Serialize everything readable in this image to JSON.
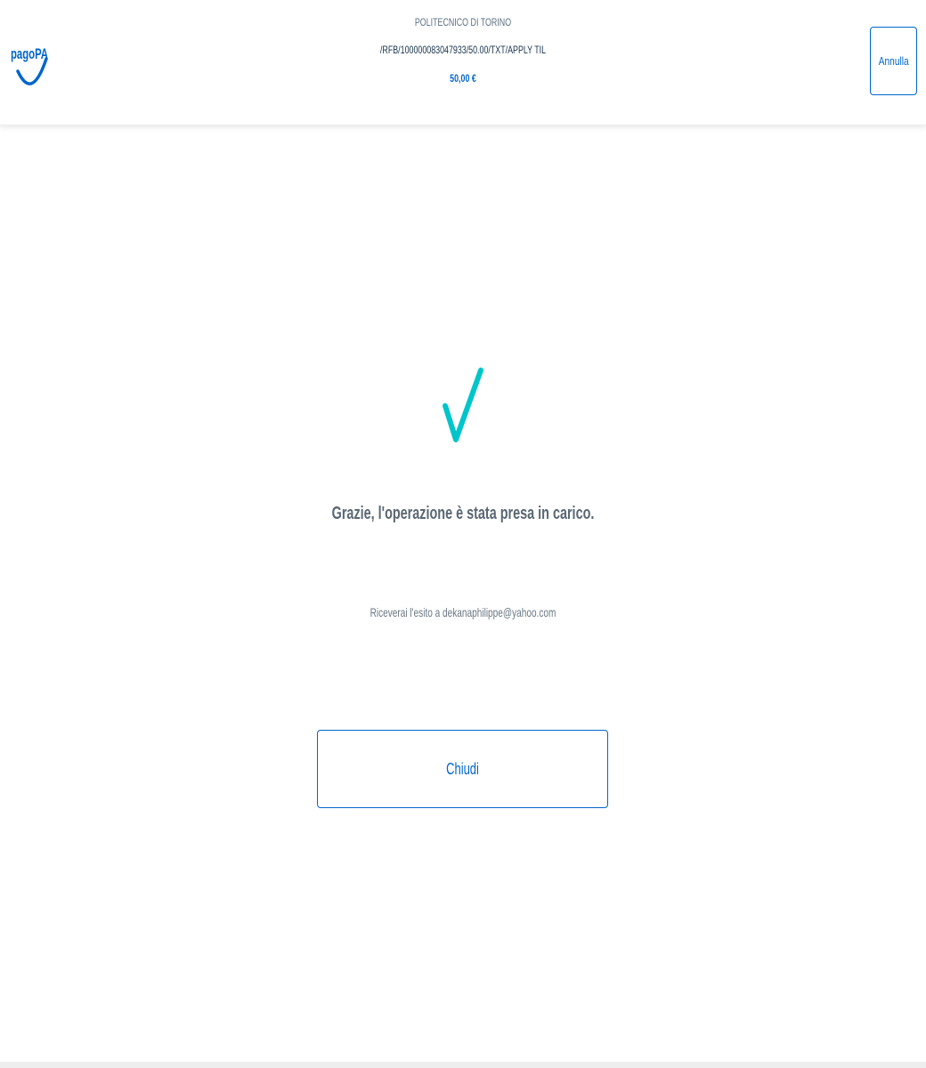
{
  "header": {
    "logo_text": "pagoPA",
    "creditor": "POLITECNICO DI TORINO",
    "subject": "/RFB/100000083047933/50.00/TXT/APPLY TIL",
    "amount": "50,00 €",
    "cancel_label": "Annulla"
  },
  "result": {
    "icon": "checkmark-icon",
    "message": "Grazie, l'operazione è stata presa in carico.",
    "email_note": "Riceverai l'esito a dekanaphilippe@yahoo.com",
    "close_label": "Chiudi"
  },
  "colors": {
    "brand_blue": "#0066cc",
    "check_teal": "#00c5ca",
    "text_gray": "#5a6772"
  }
}
